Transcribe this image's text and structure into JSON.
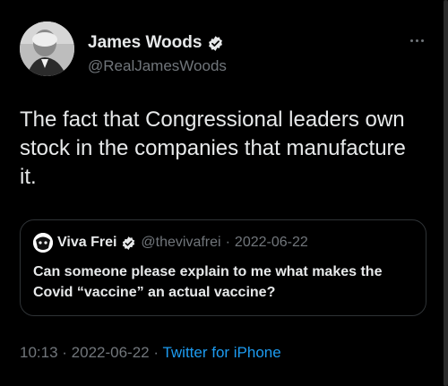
{
  "author": {
    "display_name": "James Woods",
    "handle": "@RealJamesWoods"
  },
  "tweet": {
    "text": "The fact that Congressional leaders own stock in the companies that manufacture it."
  },
  "quoted": {
    "display_name": "Viva Frei",
    "handle": "@thevivafrei",
    "separator": "·",
    "date": "2022-06-22",
    "text": "Can someone please explain to me what makes the Covid “vaccine” an actual vaccine?"
  },
  "meta": {
    "time": "10:13",
    "sep1": " · ",
    "date": "2022-06-22",
    "sep2": " · ",
    "source": "Twitter for iPhone"
  },
  "colors": {
    "background": "#000000",
    "primary_text": "#e7e9ea",
    "secondary_text": "#71767b",
    "link": "#1d9bf0",
    "border": "#2f3336"
  },
  "icons": {
    "verified": "verified-badge-icon",
    "more": "more-options-icon"
  }
}
